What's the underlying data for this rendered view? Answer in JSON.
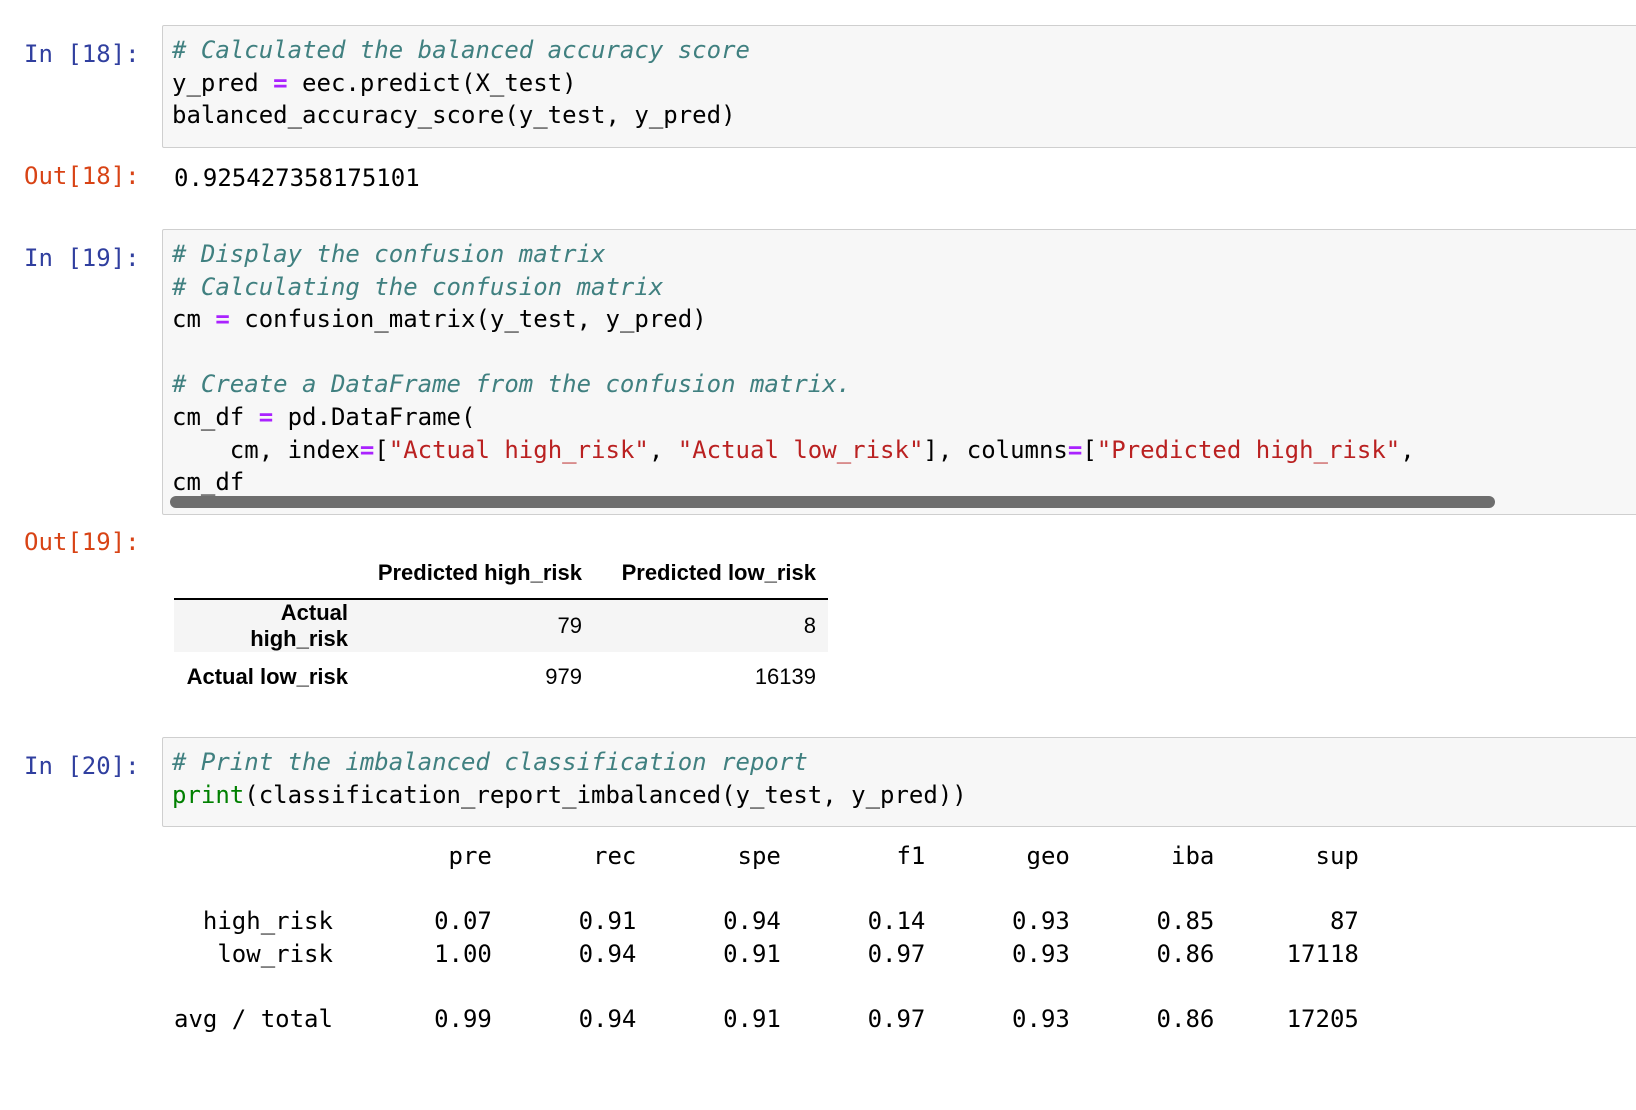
{
  "cells": [
    {
      "in_prompt": "In [18]:",
      "out_prompt": "Out[18]:",
      "code": [
        [
          {
            "t": "# Calculated the balanced accuracy score",
            "k": "c"
          }
        ],
        [
          {
            "t": "y_pred "
          },
          {
            "t": "=",
            "k": "o"
          },
          {
            "t": " eec.predict(X_test)"
          }
        ],
        [
          {
            "t": "balanced_accuracy_score(y_test, y_pred)"
          }
        ]
      ],
      "output": "0.925427358175101"
    },
    {
      "in_prompt": "In [19]:",
      "out_prompt": "Out[19]:",
      "code": [
        [
          {
            "t": "# Display the confusion matrix",
            "k": "c"
          }
        ],
        [
          {
            "t": "# Calculating the confusion matrix",
            "k": "c"
          }
        ],
        [
          {
            "t": "cm "
          },
          {
            "t": "=",
            "k": "o"
          },
          {
            "t": " confusion_matrix(y_test, y_pred)"
          }
        ],
        [],
        [
          {
            "t": "# Create a DataFrame from the confusion matrix.",
            "k": "c"
          }
        ],
        [
          {
            "t": "cm_df "
          },
          {
            "t": "=",
            "k": "o"
          },
          {
            "t": " pd.DataFrame("
          }
        ],
        [
          {
            "t": "    cm, index"
          },
          {
            "t": "=",
            "k": "o"
          },
          {
            "t": "["
          },
          {
            "t": "\"Actual high_risk\"",
            "k": "s"
          },
          {
            "t": ", "
          },
          {
            "t": "\"Actual low_risk\"",
            "k": "s"
          },
          {
            "t": "], columns"
          },
          {
            "t": "=",
            "k": "o"
          },
          {
            "t": "["
          },
          {
            "t": "\"Predicted high_risk\"",
            "k": "s"
          },
          {
            "t": ", "
          }
        ],
        [
          {
            "t": "cm_df"
          }
        ]
      ],
      "dataframe": {
        "columns": [
          "",
          "Predicted high_risk",
          "Predicted low_risk"
        ],
        "rows": [
          {
            "label": "Actual high_risk",
            "values": [
              "79",
              "8"
            ]
          },
          {
            "label": "Actual low_risk",
            "values": [
              "979",
              "16139"
            ]
          }
        ]
      }
    },
    {
      "in_prompt": "In [20]:",
      "code": [
        [
          {
            "t": "# Print the imbalanced classification report",
            "k": "c"
          }
        ],
        [
          {
            "t": "print",
            "k": "b"
          },
          {
            "t": "(classification_report_imbalanced(y_test, y_pred))"
          }
        ]
      ],
      "report": "                   pre       rec       spe        f1       geo       iba       sup\n\n  high_risk       0.07      0.91      0.94      0.14      0.93      0.85        87\n   low_risk       1.00      0.94      0.91      0.97      0.93      0.86     17118\n\navg / total       0.99      0.94      0.91      0.97      0.93      0.86     17205"
    }
  ]
}
